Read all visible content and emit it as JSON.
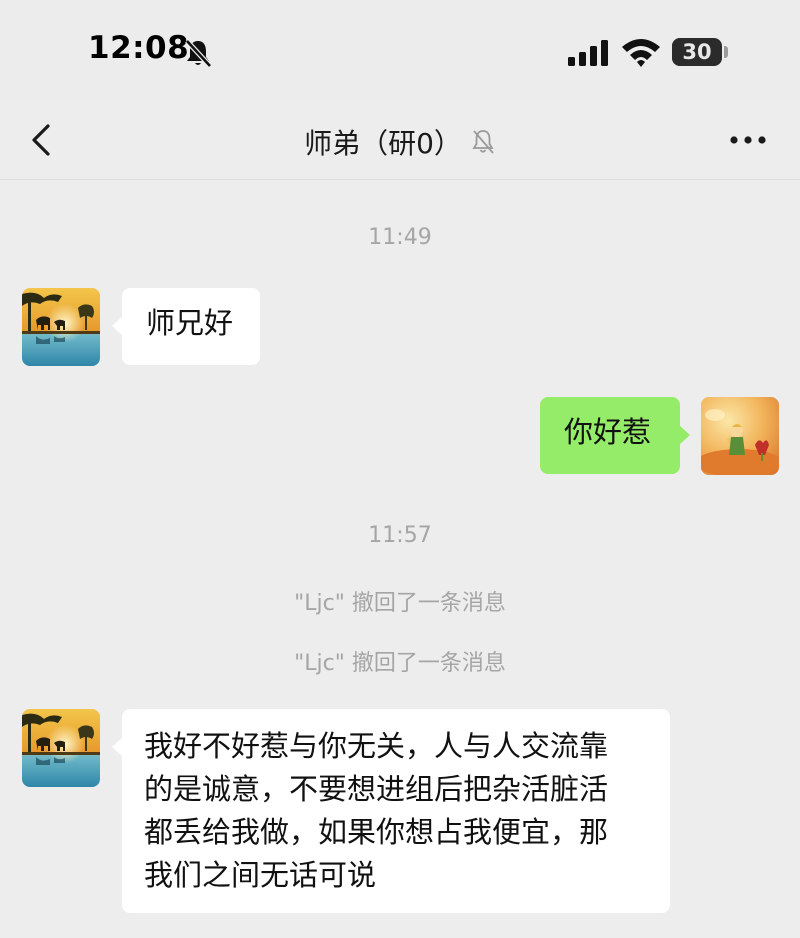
{
  "status_bar": {
    "time": "12:08",
    "battery": "30",
    "battery_level": 0.3,
    "icons": [
      "bell-slash-icon",
      "signal-icon",
      "wifi-icon",
      "battery-icon"
    ]
  },
  "header": {
    "title": "师弟（研0）",
    "icons": [
      "chevron-left-icon",
      "bell-muted-icon",
      "more-dots-icon"
    ]
  },
  "messages": [
    {
      "type": "time",
      "text": "11:49"
    },
    {
      "type": "incoming",
      "text": "师兄好"
    },
    {
      "type": "outgoing",
      "text": "你好惹"
    },
    {
      "type": "time",
      "text": "11:57"
    },
    {
      "type": "system",
      "text": "\"Ljc\" 撤回了一条消息"
    },
    {
      "type": "system",
      "text": "\"Ljc\" 撤回了一条消息"
    },
    {
      "type": "incoming",
      "lines": [
        "我好不好惹与你无关，人与人交流靠",
        "的是诚意，不要想进组后把杂活脏活",
        "都丢给我做，如果你想占我便宜，那",
        "我们之间无话可说"
      ]
    }
  ],
  "colors": {
    "background": "#ededed",
    "incoming_bubble": "#ffffff",
    "outgoing_bubble": "#95ec69",
    "meta_text": "#a5a5a5"
  }
}
